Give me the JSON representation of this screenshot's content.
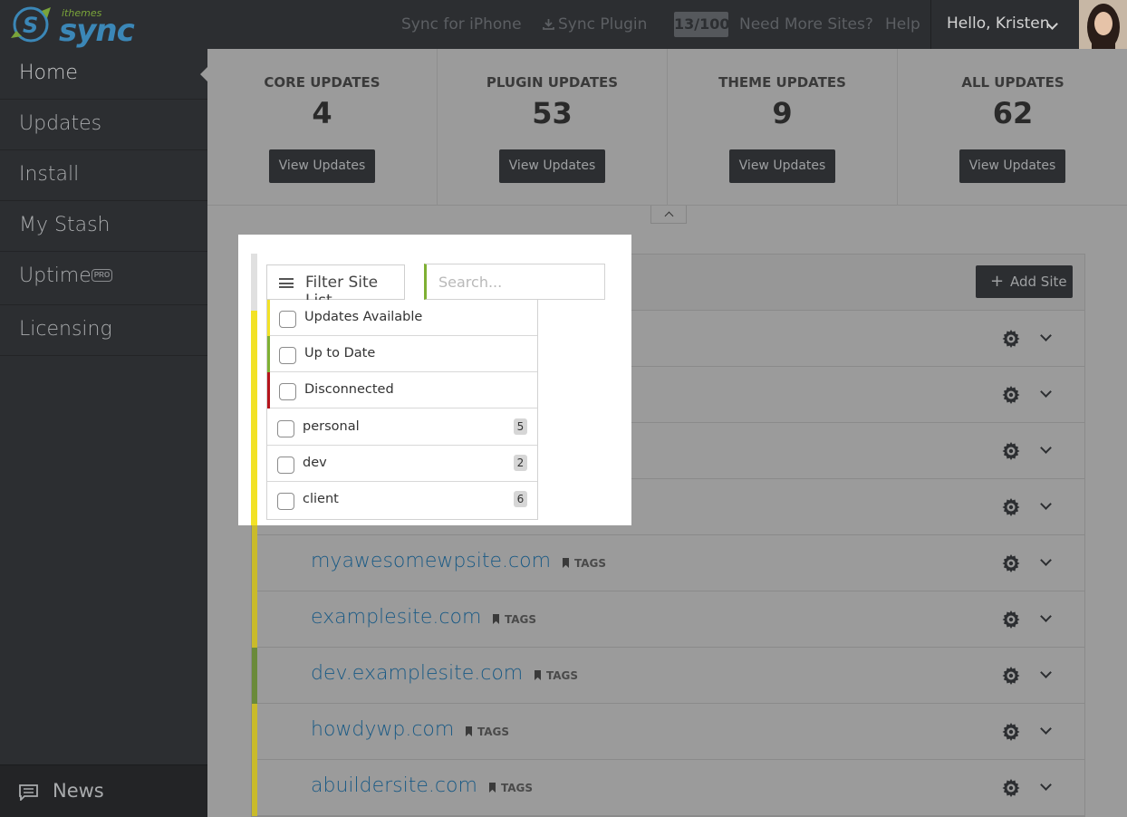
{
  "header": {
    "logo_small": "ithemes",
    "logo_big": "sync",
    "sync_iphone": "Sync for iPhone",
    "sync_plugin": "Sync Plugin",
    "site_count": "13/100",
    "need_more": "Need More Sites?",
    "help": "Help",
    "greeting": "Hello, Kristen"
  },
  "sidebar": {
    "items": [
      {
        "label": "Home"
      },
      {
        "label": "Updates"
      },
      {
        "label": "Install"
      },
      {
        "label": "My Stash"
      },
      {
        "label": "Uptime"
      },
      {
        "label": "Licensing"
      }
    ],
    "pro_badge": "PRO",
    "news": "News"
  },
  "stats": [
    {
      "title": "CORE UPDATES",
      "value": "4",
      "button": "View Updates"
    },
    {
      "title": "PLUGIN UPDATES",
      "value": "53",
      "button": "View Updates"
    },
    {
      "title": "THEME UPDATES",
      "value": "9",
      "button": "View Updates"
    },
    {
      "title": "ALL UPDATES",
      "value": "62",
      "button": "View Updates"
    }
  ],
  "site_list": {
    "add_site": "Add Site",
    "tag_label": "TAGS",
    "partial_tag": "GS",
    "sites": [
      {
        "name": "",
        "status": "updates",
        "color": "#c9bb2b"
      },
      {
        "name": "",
        "status": "updates",
        "color": "#c9bb2b"
      },
      {
        "name": "",
        "status": "updates",
        "color": "#c9bb2b"
      },
      {
        "name": "",
        "status": "updates",
        "color": "#c9bb2b"
      },
      {
        "name": "myawesomewpsite.com",
        "status": "updates",
        "color": "#c9bb2b"
      },
      {
        "name": "examplesite.com",
        "status": "updates",
        "color": "#c9bb2b"
      },
      {
        "name": "dev.examplesite.com",
        "status": "uptodate",
        "color": "#6a8a3a"
      },
      {
        "name": "howdywp.com",
        "status": "updates",
        "color": "#c9bb2b"
      },
      {
        "name": "abuildersite.com",
        "status": "updates",
        "color": "#c9bb2b"
      }
    ]
  },
  "filter": {
    "button_label": "Filter Site List",
    "search_placeholder": "Search...",
    "options": [
      {
        "label": "Updates Available",
        "color": "#f2e226"
      },
      {
        "label": "Up to Date",
        "color": "#7fb033"
      },
      {
        "label": "Disconnected",
        "color": "#b5141c"
      }
    ],
    "tags": [
      {
        "label": "personal",
        "count": "5"
      },
      {
        "label": "dev",
        "count": "2"
      },
      {
        "label": "client",
        "count": "6"
      }
    ]
  },
  "colors": {
    "accent_blue": "#3b87b7",
    "accent_green": "#7aa43a",
    "dark": "#2c2e31"
  }
}
